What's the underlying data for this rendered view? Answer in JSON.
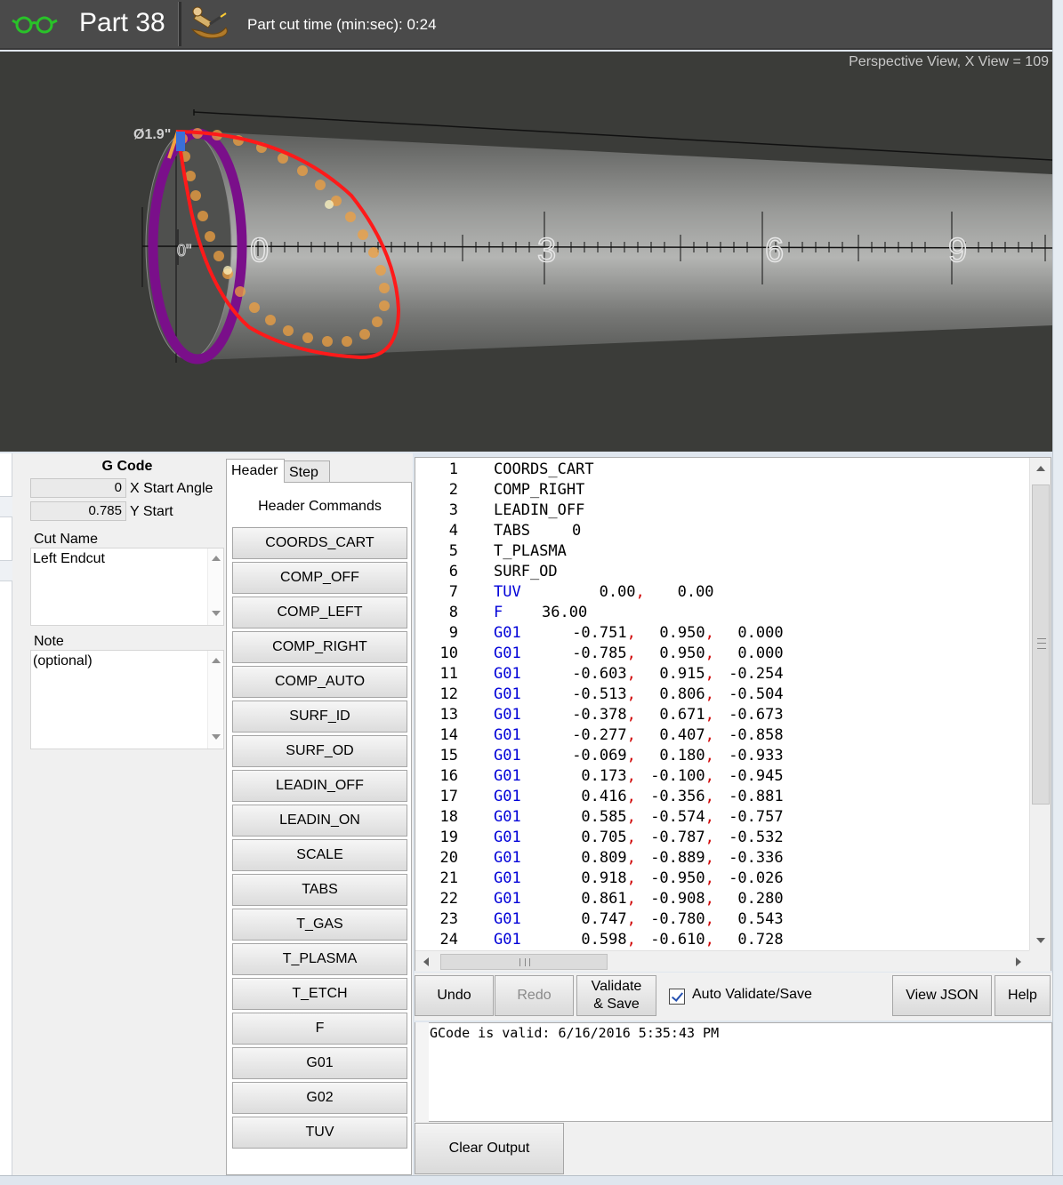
{
  "titlebar": {
    "part_title": "Part 38",
    "cut_time": "Part cut time (min:sec): 0:24"
  },
  "viewport": {
    "view_label": "Perspective View,  X View = 109",
    "diameter_label": "Ø1.9\"",
    "zero_label": "0\"",
    "scale_labels": [
      "0",
      "3",
      "6",
      "9"
    ]
  },
  "gcode_panel": {
    "title": "G Code",
    "x_start_value": "0",
    "x_start_label": "X Start Angle",
    "y_start_value": "0.785",
    "y_start_label": "Y Start",
    "cut_name_label": "Cut Name",
    "cut_name_value": "Left Endcut",
    "note_label": "Note",
    "note_placeholder": "(optional)"
  },
  "command_panel": {
    "tabs": [
      "Header",
      "Step"
    ],
    "title": "Header Commands",
    "buttons": [
      "COORDS_CART",
      "COMP_OFF",
      "COMP_LEFT",
      "COMP_RIGHT",
      "COMP_AUTO",
      "SURF_ID",
      "SURF_OD",
      "LEADIN_OFF",
      "LEADIN_ON",
      "SCALE",
      "TABS",
      "T_GAS",
      "T_PLASMA",
      "T_ETCH",
      "F",
      "G01",
      "G02",
      "TUV"
    ]
  },
  "code": {
    "lines": [
      {
        "n": "1",
        "cmd": "COORDS_CART",
        "color": "black",
        "vals": []
      },
      {
        "n": "2",
        "cmd": "COMP_RIGHT",
        "color": "black",
        "vals": []
      },
      {
        "n": "3",
        "cmd": "LEADIN_OFF",
        "color": "black",
        "vals": []
      },
      {
        "n": "4",
        "cmd": "TABS",
        "color": "black",
        "vals": [
          "0"
        ]
      },
      {
        "n": "5",
        "cmd": "T_PLASMA",
        "color": "black",
        "vals": []
      },
      {
        "n": "6",
        "cmd": "SURF_OD",
        "color": "black",
        "vals": []
      },
      {
        "n": "7",
        "cmd": "TUV",
        "color": "blue",
        "vals": [
          "0.00",
          "0.00"
        ]
      },
      {
        "n": "8",
        "cmd": "F",
        "color": "blue",
        "vals": [
          "36.00"
        ]
      },
      {
        "n": "9",
        "cmd": "G01",
        "color": "blue",
        "vals": [
          "-0.751",
          "0.950",
          "0.000"
        ]
      },
      {
        "n": "10",
        "cmd": "G01",
        "color": "blue",
        "vals": [
          "-0.785",
          "0.950",
          "0.000"
        ]
      },
      {
        "n": "11",
        "cmd": "G01",
        "color": "blue",
        "vals": [
          "-0.603",
          "0.915",
          "-0.254"
        ]
      },
      {
        "n": "12",
        "cmd": "G01",
        "color": "blue",
        "vals": [
          "-0.513",
          "0.806",
          "-0.504"
        ]
      },
      {
        "n": "13",
        "cmd": "G01",
        "color": "blue",
        "vals": [
          "-0.378",
          "0.671",
          "-0.673"
        ]
      },
      {
        "n": "14",
        "cmd": "G01",
        "color": "blue",
        "vals": [
          "-0.277",
          "0.407",
          "-0.858"
        ]
      },
      {
        "n": "15",
        "cmd": "G01",
        "color": "blue",
        "vals": [
          "-0.069",
          "0.180",
          "-0.933"
        ]
      },
      {
        "n": "16",
        "cmd": "G01",
        "color": "blue",
        "vals": [
          "0.173",
          "-0.100",
          "-0.945"
        ]
      },
      {
        "n": "17",
        "cmd": "G01",
        "color": "blue",
        "vals": [
          "0.416",
          "-0.356",
          "-0.881"
        ]
      },
      {
        "n": "18",
        "cmd": "G01",
        "color": "blue",
        "vals": [
          "0.585",
          "-0.574",
          "-0.757"
        ]
      },
      {
        "n": "19",
        "cmd": "G01",
        "color": "blue",
        "vals": [
          "0.705",
          "-0.787",
          "-0.532"
        ]
      },
      {
        "n": "20",
        "cmd": "G01",
        "color": "blue",
        "vals": [
          "0.809",
          "-0.889",
          "-0.336"
        ]
      },
      {
        "n": "21",
        "cmd": "G01",
        "color": "blue",
        "vals": [
          "0.918",
          "-0.950",
          "-0.026"
        ]
      },
      {
        "n": "22",
        "cmd": "G01",
        "color": "blue",
        "vals": [
          "0.861",
          "-0.908",
          "0.280"
        ]
      },
      {
        "n": "23",
        "cmd": "G01",
        "color": "blue",
        "vals": [
          "0.747",
          "-0.780",
          "0.543"
        ]
      },
      {
        "n": "24",
        "cmd": "G01",
        "color": "blue",
        "vals": [
          "0.598",
          "-0.610",
          "0.728"
        ]
      }
    ]
  },
  "actions": {
    "undo": "Undo",
    "redo": "Redo",
    "validate_line1": "Validate",
    "validate_line2": "& Save",
    "auto_validate": "Auto Validate/Save",
    "auto_validate_checked": true,
    "view_json": "View JSON",
    "help": "Help"
  },
  "output": {
    "text": "GCode is valid: 6/16/2016 5:35:43 PM",
    "clear_label": "Clear Output"
  },
  "colors": {
    "titlebar_bg": "#4a4a4a",
    "viewport_bg": "#3b3c39",
    "keyword_blue": "#0000d8",
    "comma_red": "#d00000",
    "ring_purple": "#7a0f8a",
    "cut_red": "#ff1a1a",
    "cut_orange": "#f0a040",
    "glasses_green": "#29c229"
  },
  "icons": [
    "glasses-icon",
    "plasma-cutter-icon"
  ]
}
